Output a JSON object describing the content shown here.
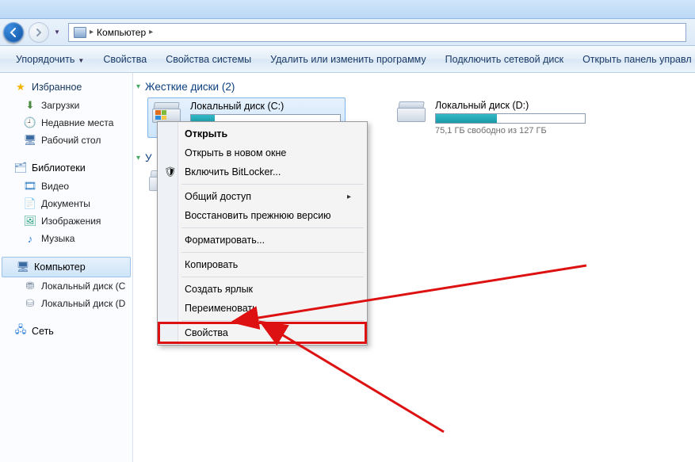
{
  "breadcrumb": {
    "root_label": "Компьютер"
  },
  "toolbar": {
    "organize": "Упорядочить",
    "properties": "Свойства",
    "system_properties": "Свойства системы",
    "uninstall": "Удалить или изменить программу",
    "map_drive": "Подключить сетевой диск",
    "control_panel": "Открыть панель управл"
  },
  "sidebar": {
    "favorites": {
      "header": "Избранное",
      "items": [
        {
          "label": "Загрузки",
          "icon": "download-icon"
        },
        {
          "label": "Недавние места",
          "icon": "recent-icon"
        },
        {
          "label": "Рабочий стол",
          "icon": "desktop-icon"
        }
      ]
    },
    "libraries": {
      "header": "Библиотеки",
      "items": [
        {
          "label": "Видео",
          "icon": "video-icon"
        },
        {
          "label": "Документы",
          "icon": "documents-icon"
        },
        {
          "label": "Изображения",
          "icon": "images-icon"
        },
        {
          "label": "Музыка",
          "icon": "music-icon"
        }
      ]
    },
    "computer": {
      "header": "Компьютер",
      "items": [
        {
          "label": "Локальный диск (C",
          "icon": "drive-icon"
        },
        {
          "label": "Локальный диск (D",
          "icon": "drive-icon"
        }
      ]
    },
    "network": {
      "header": "Сеть"
    }
  },
  "content": {
    "section_hard_drives": "Жесткие диски (2)",
    "section_removable_prefix": "У",
    "drives": [
      {
        "label": "Локальный диск (C:)",
        "fill_percent": 16,
        "info": ""
      },
      {
        "label": "Локальный диск (D:)",
        "fill_percent": 41,
        "info": "75,1 ГБ свободно из 127 ГБ"
      }
    ]
  },
  "context_menu": {
    "items": [
      {
        "label": "Открыть",
        "bold": true
      },
      {
        "label": "Открыть в новом окне"
      },
      {
        "label": "Включить BitLocker...",
        "icon": "shield-icon"
      },
      {
        "sep": true
      },
      {
        "label": "Общий доступ",
        "submenu": true
      },
      {
        "label": "Восстановить прежнюю версию"
      },
      {
        "sep": true
      },
      {
        "label": "Форматировать..."
      },
      {
        "sep": true
      },
      {
        "label": "Копировать"
      },
      {
        "sep": true
      },
      {
        "label": "Создать ярлык"
      },
      {
        "label": "Переименовать"
      },
      {
        "sep": true
      },
      {
        "label": "Свойства",
        "highlight": true
      }
    ]
  }
}
